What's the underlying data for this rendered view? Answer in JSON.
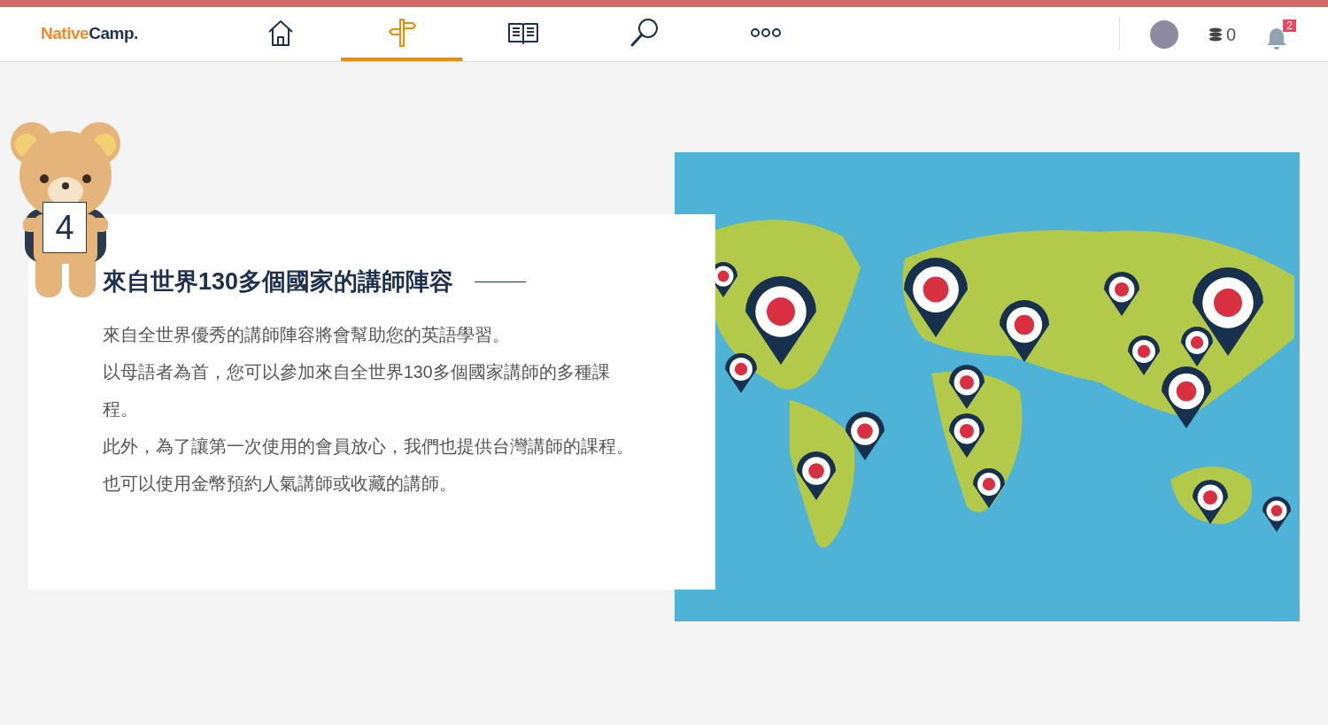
{
  "header": {
    "logo": {
      "part_1": "Native",
      "part_2": "Camp."
    },
    "nav_tabs": [
      {
        "kind": "home",
        "selected": false
      },
      {
        "kind": "signpost",
        "selected": true
      },
      {
        "kind": "book",
        "selected": false
      },
      {
        "kind": "search",
        "selected": false
      },
      {
        "kind": "more",
        "selected": false
      }
    ],
    "coins": "0",
    "notifications": "2"
  },
  "feature": {
    "number": "4",
    "title": "來自世界130多個國家的講師陣容",
    "paragraphs": [
      "來自全世界優秀的講師陣容將會幫助您的英語學習。",
      "以母語者為首，您可以參加來自全世界130多個國家講師的多種課程。",
      "此外，為了讓第一次使用的會員放心，我們也提供台灣講師的課程。",
      "也可以使用金幣預約人氣講師或收藏的講師。"
    ]
  }
}
